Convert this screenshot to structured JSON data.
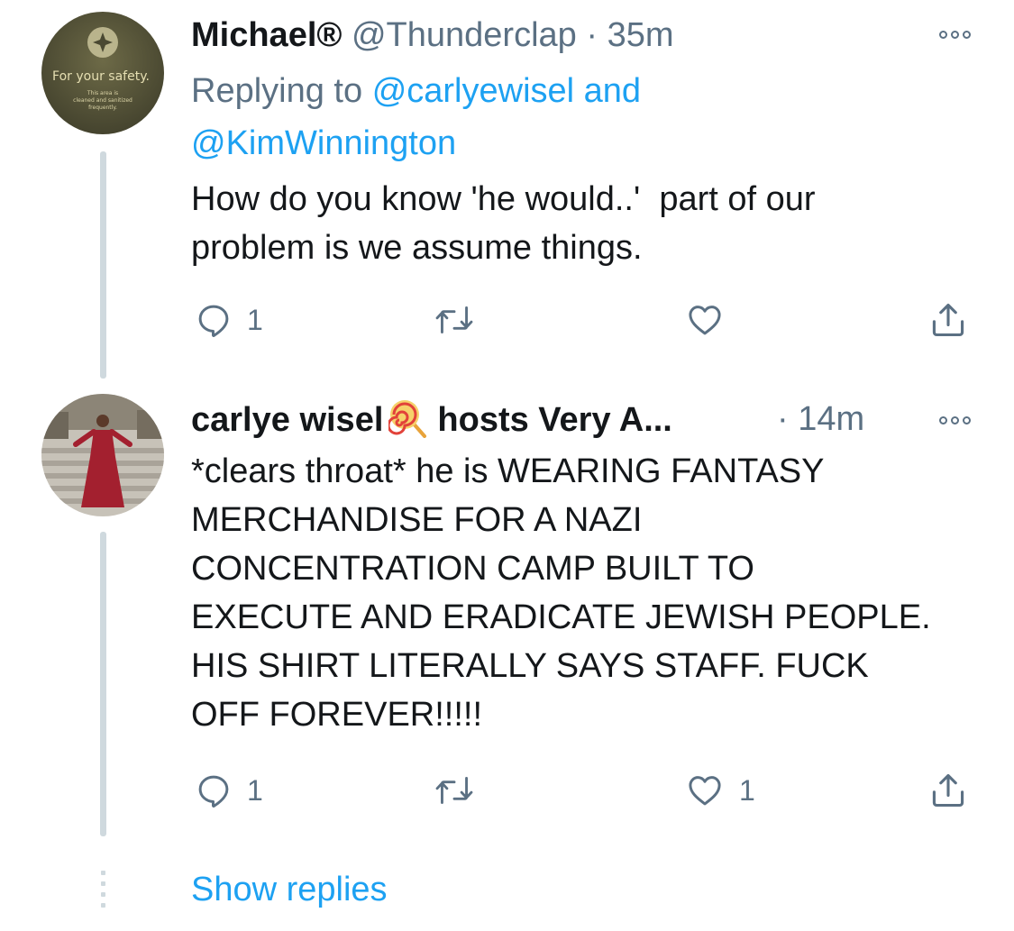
{
  "tweets": [
    {
      "name": "Michael®",
      "handle": "@Thunderclap",
      "separator": "·",
      "time": "35m",
      "avatar": {
        "description_text": "For your safety.",
        "small_text": "This area is cleaned and sanitized frequently."
      },
      "replying_prefix": "Replying to",
      "replying_user1": "@carlyewisel",
      "replying_and": "and",
      "replying_user2": "@KimWinnington",
      "text_line1": "How do you know 'he would..'  part of our",
      "text_line2": "problem is we assume things.",
      "reply_count": "1",
      "retweet_count": "",
      "like_count": ""
    },
    {
      "name": "carlye wisel",
      "name_suffix": "hosts Very A...",
      "separator": "·",
      "time": "14m",
      "text_lines": [
        "*clears throat* he is WEARING FANTASY",
        "MERCHANDISE FOR A NAZI",
        "CONCENTRATION CAMP BUILT TO",
        "EXECUTE AND ERADICATE JEWISH PEOPLE.",
        "HIS SHIRT LITERALLY SAYS STAFF. FUCK",
        "OFF FOREVER!!!!!"
      ],
      "reply_count": "1",
      "retweet_count": "",
      "like_count": "1"
    }
  ],
  "show_replies": "Show replies",
  "colors": {
    "link": "#1da1f2",
    "secondary": "#5b7083",
    "text": "#14171a",
    "thread_line": "#cfd9de"
  },
  "icons": [
    "reply-icon",
    "retweet-icon",
    "like-icon",
    "share-icon",
    "more-icon",
    "lollipop-emoji"
  ]
}
